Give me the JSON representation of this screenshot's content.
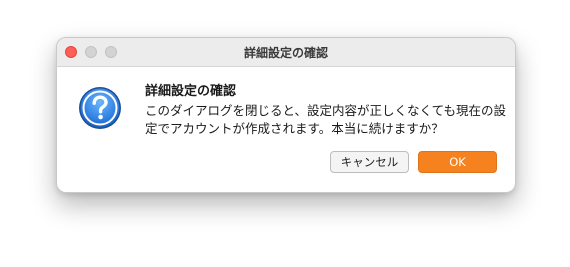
{
  "window": {
    "title": "詳細設定の確認"
  },
  "dialog": {
    "icon": "question-icon",
    "heading": "詳細設定の確認",
    "message": "このダイアログを閉じると、設定内容が正しくなくても現在の設定でアカウントが作成されます。本当に続けますか？"
  },
  "buttons": {
    "cancel_label": "キャンセル",
    "ok_label": "OK"
  },
  "colors": {
    "accent": "#f5821f",
    "close_button": "#ff5f57",
    "icon_blue": "#2f7fe0"
  }
}
